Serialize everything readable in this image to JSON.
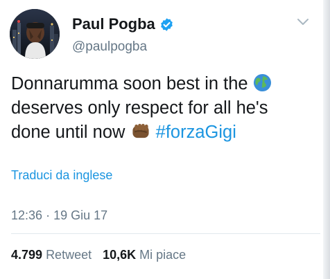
{
  "author": {
    "name": "Paul Pogba",
    "handle": "@paulpogba",
    "verified": true
  },
  "tweet": {
    "text_line1": "Donnarumma soon best in the",
    "text_line2": "deserves only respect for all he's",
    "text_line3": "done until now",
    "hashtag": "#forzaGigi",
    "emojis": [
      "globe-icon",
      "fist-icon"
    ],
    "translate_link": "Traduci da inglese"
  },
  "meta": {
    "time": "12:36",
    "separator": "·",
    "date": "19 Giu 17"
  },
  "stats": {
    "retweets_count": "4.799",
    "retweets_label": "Retweet",
    "likes_count": "10,6K",
    "likes_label": "Mi piace"
  },
  "colors": {
    "link": "#1b95e0",
    "verified": "#1da1f2",
    "secondary_text": "#657786",
    "primary_text": "#14171a"
  }
}
